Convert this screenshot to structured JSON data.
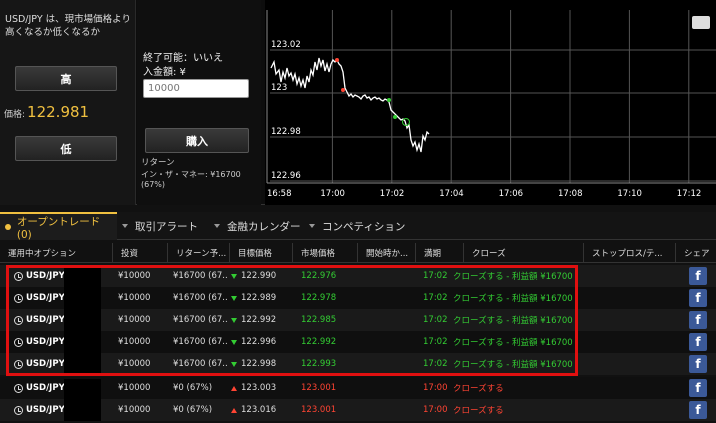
{
  "trade_panel": {
    "question": "USD/JPY は、現市場価格より高くなるか低くなるか",
    "high_label": "高",
    "low_label": "低",
    "price_label": "価格:",
    "price_value": "122.981",
    "expiry_label": "終了可能：いいえ",
    "amount_label": "入金額: ¥",
    "amount_placeholder": "10000",
    "buy_label": "購入",
    "return_label": "リターン",
    "itm_label": "イン・ザ・マネー: ¥16700 (67%)"
  },
  "chart_data": {
    "type": "line",
    "y_ticks": [
      "123.02",
      "123",
      "122.98",
      "122.96"
    ],
    "x_ticks": [
      "16:58",
      "17:00",
      "17:02",
      "17:04",
      "17:06",
      "17:08",
      "17:10",
      "17:12"
    ],
    "grid": true
  },
  "tabs": [
    {
      "label": "オープントレード (0)",
      "active": true
    },
    {
      "label": "取引アラート",
      "active": false
    },
    {
      "label": "金融カレンダー",
      "active": false
    },
    {
      "label": "コンペティション",
      "active": false
    }
  ],
  "columns": [
    "運用中オプション",
    "投資",
    "リターン予...",
    "目標価格",
    "市場価格",
    "開始時か...",
    "満期",
    "クローズ",
    "ストップロス/テ...",
    "シェア"
  ],
  "rows": [
    {
      "symbol": "USD/JPY",
      "invest": "¥10000",
      "ret": "¥16700 (67...",
      "target": "122.990",
      "market": "122.976",
      "expiry": "17:02",
      "close": "クローズする - 利益額 ¥16700",
      "win": true
    },
    {
      "symbol": "USD/JPY",
      "invest": "¥10000",
      "ret": "¥16700 (67...",
      "target": "122.989",
      "market": "122.978",
      "expiry": "17:02",
      "close": "クローズする - 利益額 ¥16700",
      "win": true
    },
    {
      "symbol": "USD/JPY",
      "invest": "¥10000",
      "ret": "¥16700 (67...",
      "target": "122.992",
      "market": "122.985",
      "expiry": "17:02",
      "close": "クローズする - 利益額 ¥16700",
      "win": true
    },
    {
      "symbol": "USD/JPY",
      "invest": "¥10000",
      "ret": "¥16700 (67...",
      "target": "122.996",
      "market": "122.992",
      "expiry": "17:02",
      "close": "クローズする - 利益額 ¥16700",
      "win": true
    },
    {
      "symbol": "USD/JPY",
      "invest": "¥10000",
      "ret": "¥16700 (67...",
      "target": "122.998",
      "market": "122.993",
      "expiry": "17:02",
      "close": "クローズする - 利益額 ¥16700",
      "win": true
    },
    {
      "symbol": "USD/JPY",
      "invest": "¥10000",
      "ret": "¥0 (67%)",
      "target": "123.003",
      "market": "123.001",
      "expiry": "17:00",
      "close": "クローズする",
      "win": false
    },
    {
      "symbol": "USD/JPY",
      "invest": "¥10000",
      "ret": "¥0 (67%)",
      "target": "123.016",
      "market": "123.001",
      "expiry": "17:00",
      "close": "クローズする",
      "win": false
    }
  ],
  "share_label": "f",
  "colors": {
    "accent": "#f0c040",
    "win": "#33cc33",
    "loss": "#ff4433",
    "highlight": "#e01010",
    "facebook": "#3b5998"
  }
}
